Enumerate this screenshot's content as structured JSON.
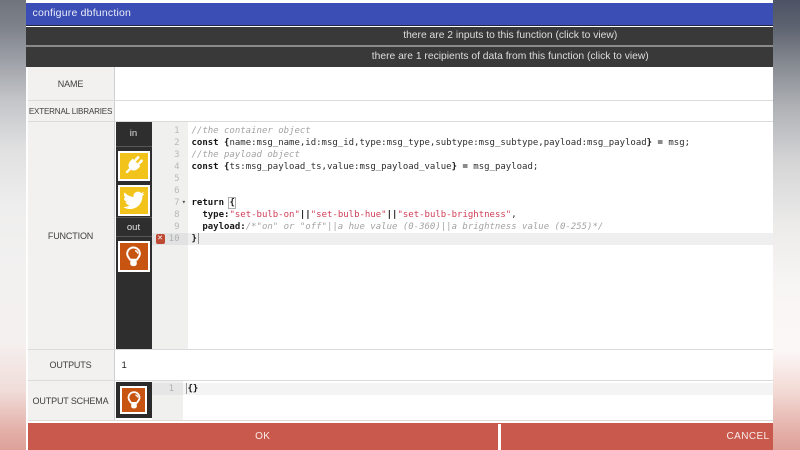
{
  "window": {
    "title": "configure dbfunction"
  },
  "banners": {
    "inputs": "there are 2 inputs to this function (click to view)",
    "outputs": "there are 1 recipients of data from this function (click to view)"
  },
  "form": {
    "name": {
      "label": "NAME",
      "value": ""
    },
    "external_libraries": {
      "label": "EXTERNAL LIBRARIES",
      "value": ""
    },
    "function": {
      "label": "FUNCTION"
    },
    "outputs": {
      "label": "OUTPUTS",
      "value": "1"
    },
    "output_schema": {
      "label": "OUTPUT SCHEMA"
    }
  },
  "function_editor": {
    "in_label": "in",
    "out_label": "out",
    "input_icons": [
      "plug-icon",
      "twitter-bird-icon"
    ],
    "output_icons": [
      "lightbulb-icon"
    ],
    "colors": {
      "string": "#cf3d55",
      "comment": "#a3a3a3",
      "keyword": "#141414",
      "icon_yellow": "#f2c41b",
      "icon_orange": "#c75410"
    },
    "error_line": 10,
    "active_line": 10,
    "fold_line": 7,
    "lines": [
      {
        "n": 1,
        "tokens": [
          [
            "comment",
            "//the container object"
          ]
        ]
      },
      {
        "n": 2,
        "tokens": [
          [
            "keyword",
            "const "
          ],
          [
            "op",
            "{"
          ],
          [
            "plain",
            "name:msg_name,id:msg_id,type:msg_type,subtype:msg_subtype,payload:msg_payload"
          ],
          [
            "op",
            "}"
          ],
          [
            "plain",
            " "
          ],
          [
            "op",
            "="
          ],
          [
            "plain",
            " msg;"
          ]
        ]
      },
      {
        "n": 3,
        "tokens": [
          [
            "comment",
            "//the payload object"
          ]
        ]
      },
      {
        "n": 4,
        "tokens": [
          [
            "keyword",
            "const "
          ],
          [
            "op",
            "{"
          ],
          [
            "plain",
            "ts:msg_payload_ts,value:msg_payload_value"
          ],
          [
            "op",
            "}"
          ],
          [
            "plain",
            " "
          ],
          [
            "op",
            "="
          ],
          [
            "plain",
            " msg_payload;"
          ]
        ]
      },
      {
        "n": 5,
        "tokens": []
      },
      {
        "n": 6,
        "tokens": []
      },
      {
        "n": 7,
        "tokens": [
          [
            "keyword",
            "return "
          ],
          [
            "matched",
            "{"
          ]
        ],
        "fold": true
      },
      {
        "n": 8,
        "tokens": [
          [
            "prop",
            "  type:"
          ],
          [
            "string",
            "\"set-bulb-on\""
          ],
          [
            "op",
            "||"
          ],
          [
            "string",
            "\"set-bulb-hue\""
          ],
          [
            "op",
            "||"
          ],
          [
            "string",
            "\"set-bulb-brightness\""
          ],
          [
            "plain",
            ","
          ]
        ]
      },
      {
        "n": 9,
        "tokens": [
          [
            "prop",
            "  payload:"
          ],
          [
            "comment",
            "/*\"on\" or \"off\"||a hue value (0-360)||a brightness value (0-255)*/"
          ]
        ]
      },
      {
        "n": 10,
        "tokens": [
          [
            "op",
            "}"
          ]
        ],
        "error": true,
        "active": true,
        "cursor": true
      }
    ]
  },
  "schema_editor": {
    "active_line": 1,
    "lines": [
      {
        "n": 1,
        "tokens": [
          [
            "op",
            "{}"
          ]
        ],
        "active": true,
        "cursor": true
      }
    ]
  },
  "footer": {
    "ok": "OK",
    "cancel": "CANCEL"
  }
}
